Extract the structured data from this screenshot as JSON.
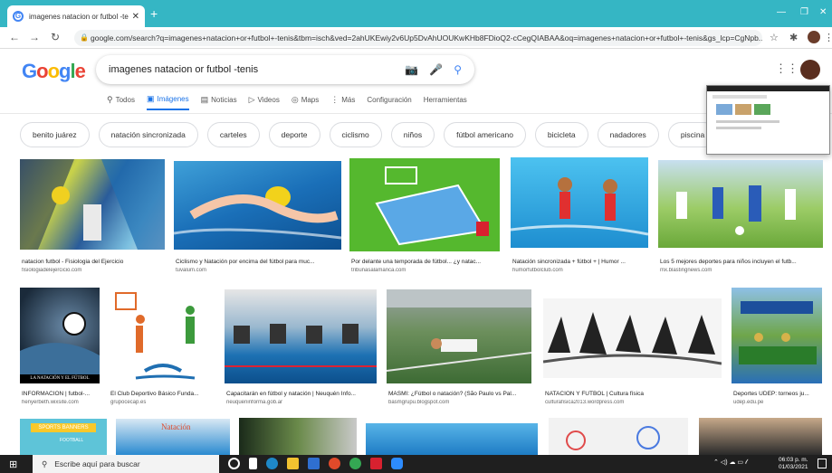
{
  "browser": {
    "tab_title": "imagenes natacion or futbol -teni",
    "url": "google.com/search?q=imagenes+natacion+or+futbol+-tenis&tbm=isch&ved=2ahUKEwiy2v6Up5DvAhUOUKwKHb8FDioQ2-cCegQIABAA&oq=imagenes+natacion+or+futbol+-tenis&gs_lcp=CgNpb..."
  },
  "search": {
    "query": "imagenes natacion or futbol -tenis"
  },
  "tabs": [
    {
      "label": "Todos",
      "icon": "search-icon"
    },
    {
      "label": "Imágenes",
      "icon": "image-icon",
      "active": true
    },
    {
      "label": "Noticias",
      "icon": "news-icon"
    },
    {
      "label": "Videos",
      "icon": "play-icon"
    },
    {
      "label": "Maps",
      "icon": "pin-icon"
    },
    {
      "label": "Más",
      "icon": "more-icon"
    },
    {
      "label": "Configuración"
    },
    {
      "label": "Herramientas"
    }
  ],
  "chips": [
    "benito juárez",
    "natación sincronizada",
    "carteles",
    "deporte",
    "ciclismo",
    "niños",
    "fútbol americano",
    "bicicleta",
    "nadadores",
    "piscina"
  ],
  "results_row1": [
    {
      "caption": "natacion futbol - Fisiologia del Ejercicio",
      "source": "fisiologiadelejercicio.com"
    },
    {
      "caption": "Ciclismo y Natación por encima del fútbol para muc...",
      "source": "tuvalum.com"
    },
    {
      "caption": "Por delante una temporada de fútbol... ¿y natac...",
      "source": "tribunasalamanca.com"
    },
    {
      "caption": "Natación sincronizada + fútbol + | Humor ...",
      "source": "humorfutbolclub.com"
    },
    {
      "caption": "Los 5 mejores deportes para niños incluyen el futb...",
      "source": "mx.blastingnews.com"
    }
  ],
  "results_row2": [
    {
      "caption": "INFORMACIÓN | futbol-...",
      "source": "henyerbeth.wixsite.com",
      "overlay": "LA NATACIÓN Y EL FÚTBOL"
    },
    {
      "caption": "El Club Deportivo Básico Funda...",
      "source": "grupocecap.es"
    },
    {
      "caption": "Capacitarán en fútbol y natación | Neuquén Info...",
      "source": "neuqueninforma.gob.ar"
    },
    {
      "caption": "MASMI: ¿Fútbol o natación? (São Paulo vs Pal...",
      "source": "basmgrupu.blogspot.com"
    },
    {
      "caption": "NATACION Y FUTBOL | Cultura física",
      "source": "culturafisica2013.wordpress.com"
    },
    {
      "caption": "Deportes UDEP: torneos ju...",
      "source": "udep.edu.pe"
    }
  ],
  "row3_texts": {
    "banner": "SPORTS BANNERS",
    "football": "FOOTBALL",
    "natacion": "Natación"
  },
  "taskbar": {
    "search_placeholder": "Escribe aquí para buscar",
    "time": "06:03 p. m.",
    "date": "01/03/2021"
  }
}
